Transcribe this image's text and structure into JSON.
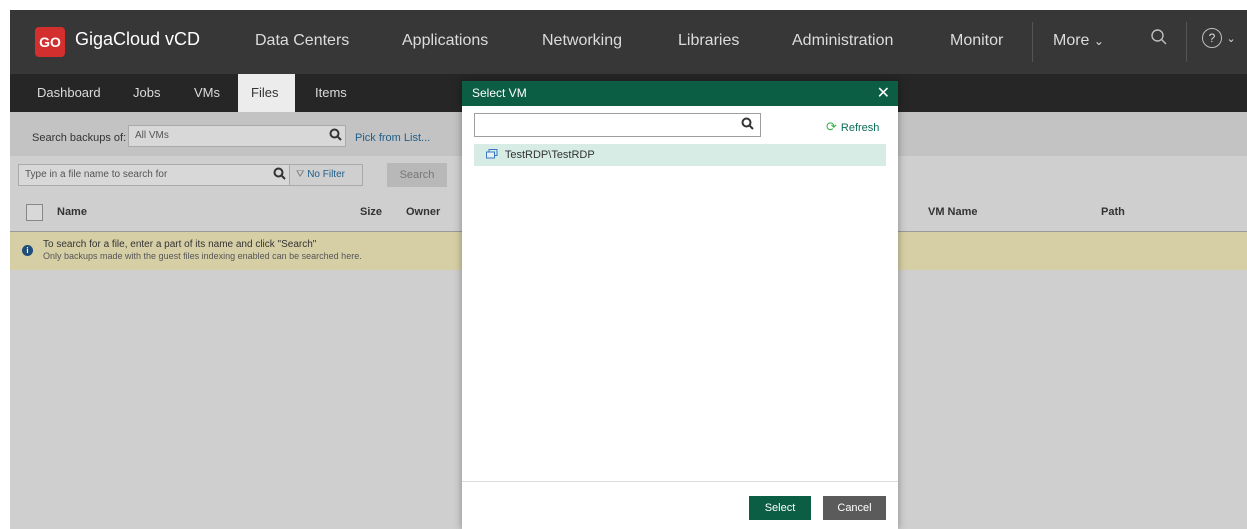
{
  "app": {
    "logo_text": "GO",
    "title": "GigaCloud vCD"
  },
  "topnav": {
    "items": [
      "Data Centers",
      "Applications",
      "Networking",
      "Libraries",
      "Administration",
      "Monitor"
    ],
    "more_label": "More",
    "more_chevron": "⌄",
    "help_glyph": "?",
    "help_chevron": "⌄"
  },
  "subnav": {
    "tabs": [
      "Dashboard",
      "Jobs",
      "VMs",
      "Files",
      "Items"
    ],
    "active": "Files"
  },
  "toolbar": {
    "search_backups_label": "Search backups of:",
    "search_backups_value": "All VMs",
    "pick_from_list": "Pick from List...",
    "file_search_placeholder": "Type in a file name to search for",
    "no_filter": "No Filter",
    "search_button": "Search"
  },
  "table": {
    "columns": [
      "Name",
      "Size",
      "Owner",
      "VM Name",
      "Path"
    ]
  },
  "info": {
    "line1": "To search for a file, enter a part of its name and click \"Search\"",
    "line2": "Only backups made with the guest files indexing enabled can be searched here."
  },
  "modal": {
    "title": "Select VM",
    "close_glyph": "✕",
    "search_value": "",
    "refresh_label": "Refresh",
    "items": [
      "TestRDP\\TestRDP"
    ],
    "select_label": "Select",
    "cancel_label": "Cancel"
  },
  "colors": {
    "brand_red": "#d32f2f",
    "modal_green": "#0b5e44",
    "selected_row": "#d6ece4",
    "info_bg": "#d6cfa6"
  }
}
